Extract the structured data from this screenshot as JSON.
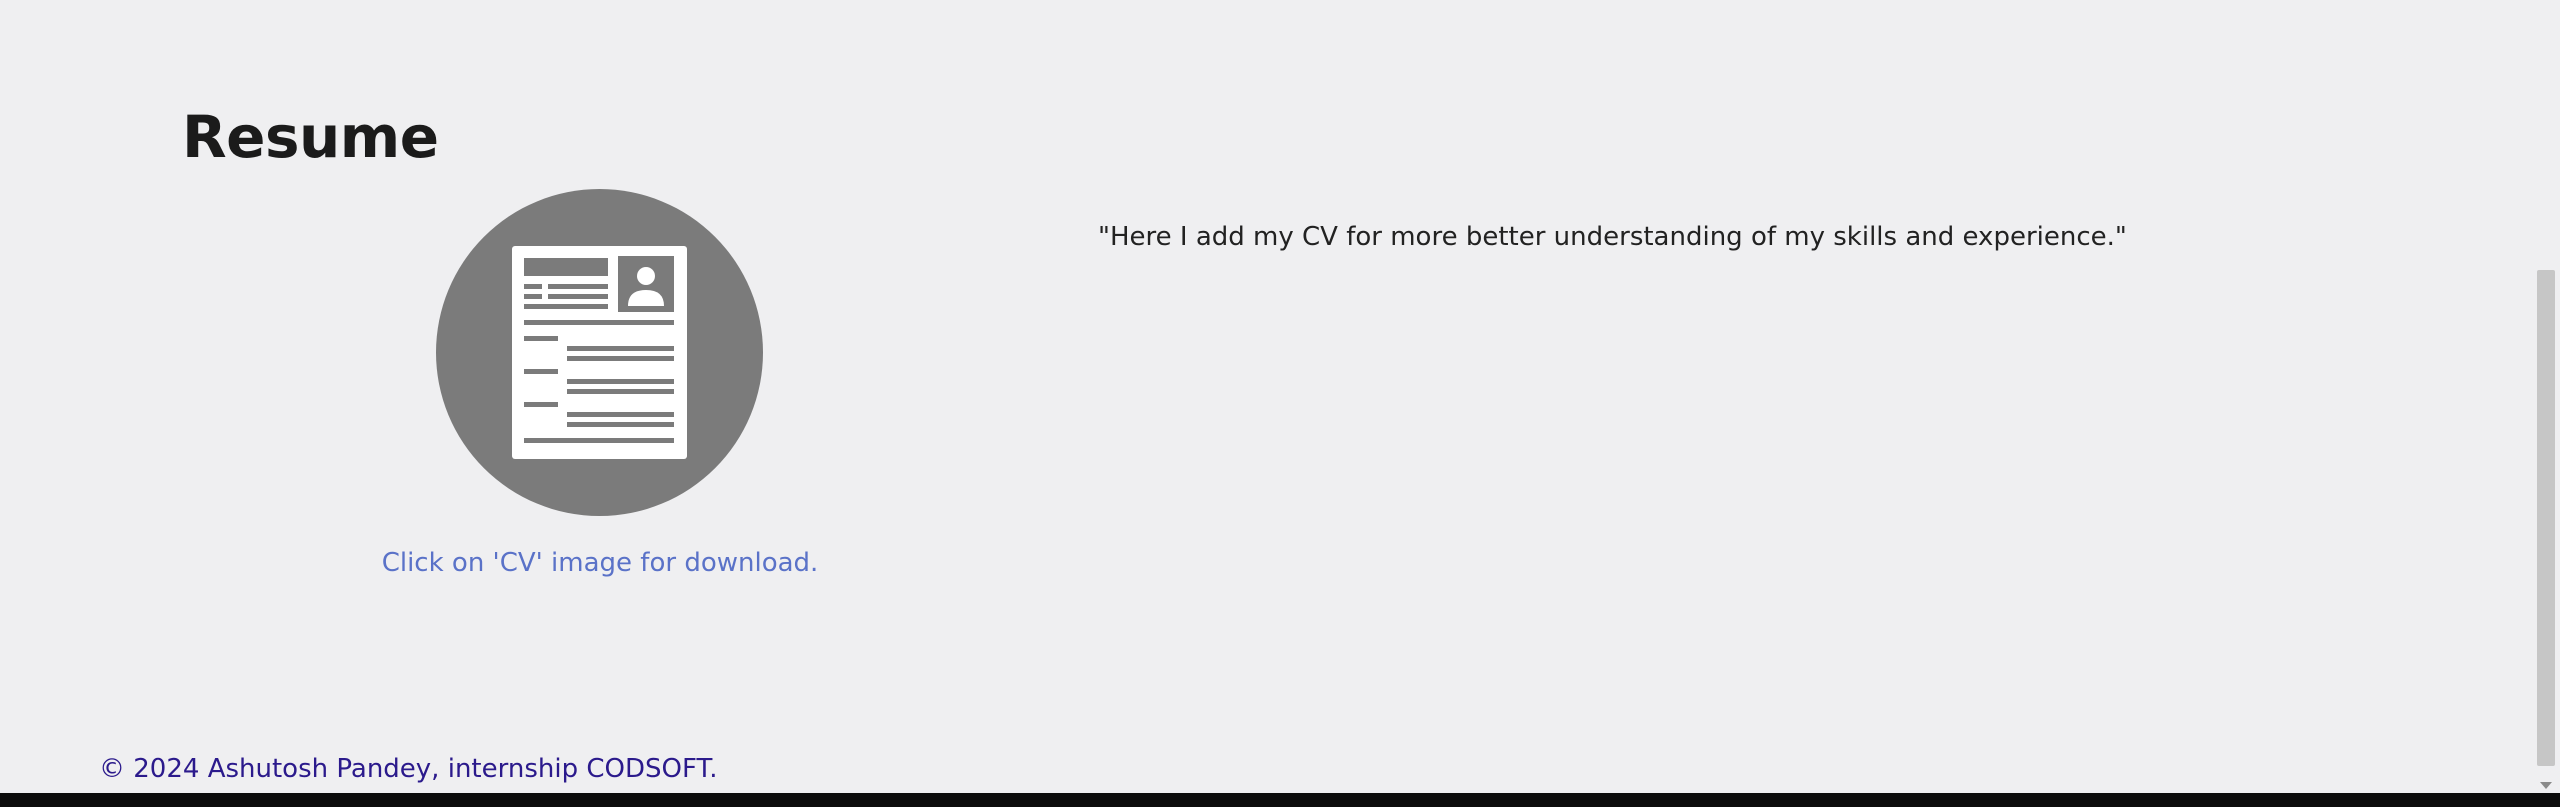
{
  "resume": {
    "title": "Resume",
    "caption": "Click on 'CV' image for download.",
    "quote": "\"Here I add my CV for more better understanding of my skills and experience.\"",
    "cv_icon": "resume-document-icon"
  },
  "footer": {
    "text": "© 2024 Ashutosh Pandey, internship CODSOFT."
  },
  "colors": {
    "background": "#efeff1",
    "heading": "#1b1b1b",
    "caption": "#5a72c8",
    "footer": "#2b1a8c",
    "icon_circle": "#7b7b7b"
  }
}
